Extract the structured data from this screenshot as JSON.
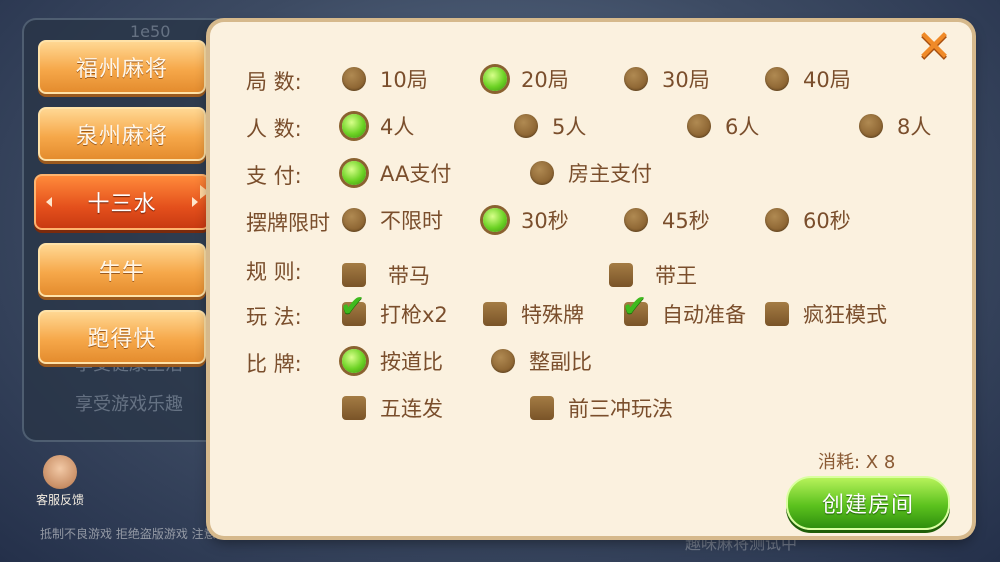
{
  "background": {
    "id_text": "1e50",
    "faded_lines": [
      "享受健康生活",
      "享受游戏乐趣"
    ],
    "footer_left": "抵制不良游戏 拒绝盗版游戏 注意自我保护 谨防受骗上当 适度游戏益脑 沉迷游戏伤身 合理安排时间 享受健康生活",
    "footer_right": "趣味麻将测试中",
    "service_label": "客服反馈"
  },
  "tabs": [
    {
      "label": "福州麻将",
      "active": false
    },
    {
      "label": "泉州麻将",
      "active": false
    },
    {
      "label": "十三水",
      "active": true
    },
    {
      "label": "牛牛",
      "active": false
    },
    {
      "label": "跑得快",
      "active": false
    }
  ],
  "settings": {
    "rounds": {
      "label": "局  数:",
      "options": [
        "10局",
        "20局",
        "30局",
        "40局"
      ],
      "selected": 1
    },
    "players": {
      "label": "人  数:",
      "options": [
        "4人",
        "5人",
        "6人",
        "8人"
      ],
      "selected": 0
    },
    "payment": {
      "label": "支  付:",
      "options": [
        "AA支付",
        "房主支付"
      ],
      "selected": 0
    },
    "time_limit": {
      "label": "摆牌限时",
      "options": [
        "不限时",
        "30秒",
        "45秒",
        "60秒"
      ],
      "selected": 1
    },
    "rules": {
      "label": "规  则:",
      "options": [
        {
          "text": "带马",
          "checked": false
        },
        {
          "text": "带王",
          "checked": false
        }
      ]
    },
    "play": {
      "label": "玩  法:",
      "options": [
        {
          "text": "打枪x2",
          "checked": true
        },
        {
          "text": "特殊牌",
          "checked": false
        },
        {
          "text": "自动准备",
          "checked": true
        },
        {
          "text": "疯狂模式",
          "checked": false
        }
      ]
    },
    "compare": {
      "label": "比  牌:",
      "options": [
        "按道比",
        "整副比"
      ],
      "selected": 0
    },
    "extras": {
      "options": [
        {
          "text": "五连发",
          "checked": false
        },
        {
          "text": "前三冲玩法",
          "checked": false
        }
      ]
    }
  },
  "cost": "消耗: X 8",
  "create_button": "创建房间",
  "colors": {
    "accent_orange": "#e4501c",
    "selected_green": "#6cd224",
    "panel_bg": "#fbf1df",
    "text_brown": "#7a4e2c"
  }
}
